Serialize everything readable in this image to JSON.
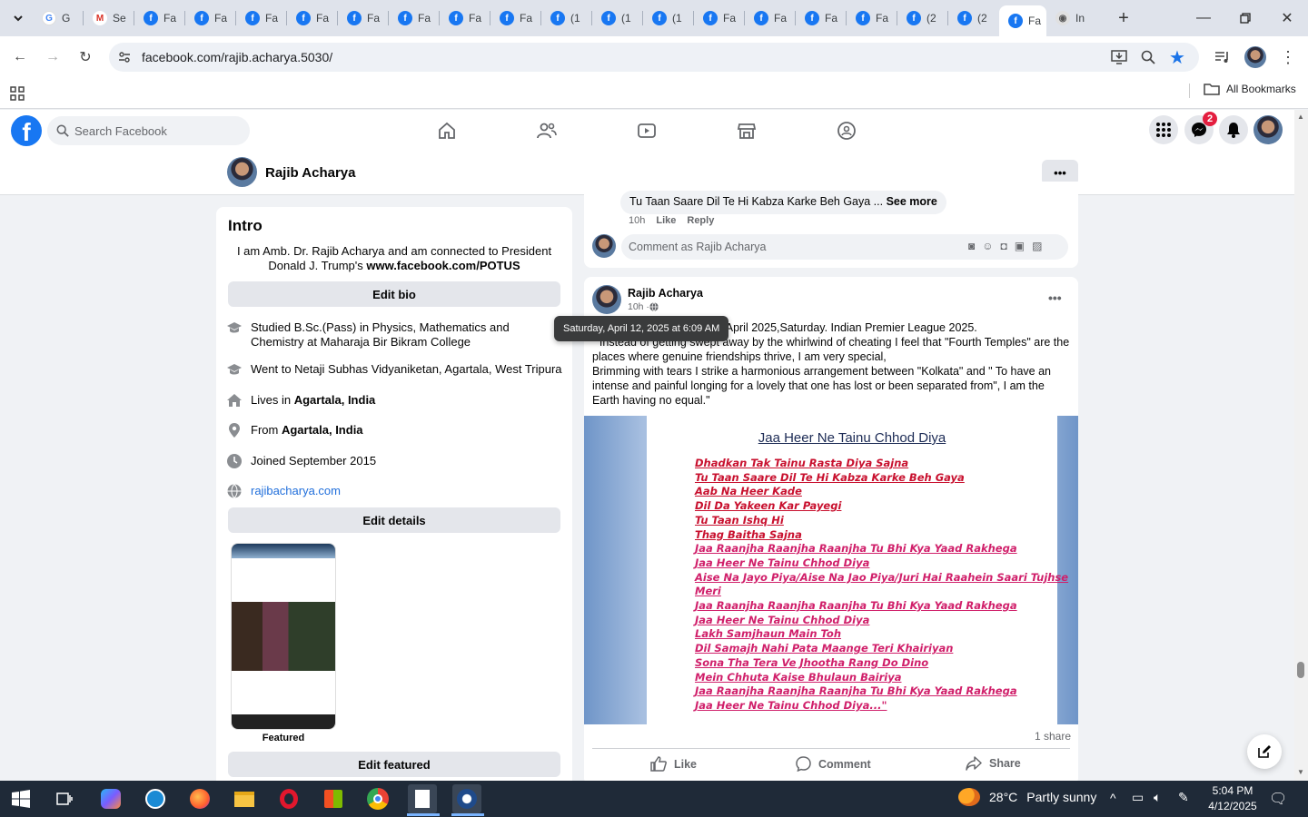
{
  "browser": {
    "tabs": [
      {
        "label": "G",
        "icon": "google"
      },
      {
        "label": "Se",
        "icon": "gmail"
      },
      {
        "label": "Fa",
        "icon": "facebook"
      },
      {
        "label": "Fa",
        "icon": "facebook"
      },
      {
        "label": "Fa",
        "icon": "facebook"
      },
      {
        "label": "Fa",
        "icon": "facebook"
      },
      {
        "label": "Fa",
        "icon": "facebook"
      },
      {
        "label": "Fa",
        "icon": "facebook"
      },
      {
        "label": "Fa",
        "icon": "facebook"
      },
      {
        "label": "Fa",
        "icon": "facebook"
      },
      {
        "label": "(1",
        "icon": "facebook"
      },
      {
        "label": "(1",
        "icon": "facebook"
      },
      {
        "label": "(1",
        "icon": "facebook"
      },
      {
        "label": "Fa",
        "icon": "facebook"
      },
      {
        "label": "Fa",
        "icon": "facebook"
      },
      {
        "label": "Fa",
        "icon": "facebook"
      },
      {
        "label": "Fa",
        "icon": "facebook"
      },
      {
        "label": "(2",
        "icon": "facebook"
      },
      {
        "label": "(2",
        "icon": "facebook"
      },
      {
        "label": "Fa",
        "icon": "facebook",
        "active": true
      },
      {
        "label": "In",
        "icon": "globe"
      }
    ],
    "url": "facebook.com/rajib.acharya.5030/",
    "bookmarks_label": "All Bookmarks"
  },
  "fb": {
    "search_placeholder": "Search Facebook",
    "messenger_badge": "2",
    "profile_name": "Rajib Acharya"
  },
  "intro": {
    "title": "Intro",
    "bio_text": "I am Amb. Dr. Rajib Acharya and am connected to President Donald J. Trump's ",
    "bio_link": "www.facebook.com/POTUS",
    "edit_bio": "Edit bio",
    "studied": "Studied B.Sc.(Pass) in Physics, Mathematics and Chemistry at Maharaja Bir Bikram College",
    "went": "Went to Netaji Subhas Vidyaniketan, Agartala, West Tripura",
    "lives_prefix": "Lives in ",
    "lives_place": "Agartala, India",
    "from_prefix": "From ",
    "from_place": "Agartala, India",
    "joined": "Joined September 2015",
    "website": "rajibacharya.com",
    "edit_details": "Edit details",
    "featured_label": "Featured",
    "edit_featured": "Edit featured"
  },
  "comment": {
    "text": "Tu Taan Saare Dil Te Hi Kabza Karke Beh Gaya ... ",
    "see_more": "See more",
    "time": "10h",
    "like": "Like",
    "reply": "Reply",
    "placeholder": "Comment as Rajib Acharya"
  },
  "post": {
    "author": "Rajib Acharya",
    "time": "10h · ",
    "tooltip": "Saturday, April 12, 2025 at 6:09 AM",
    "line1_tail": "2 April 2025,Saturday. Indian Premier League 2025.",
    "line2": "\" Instead of getting swept away by the whirlwind of cheating I feel that \"Fourth Temples\" are the places where genuine friendships thrive, I am very special,",
    "line3": "Brimming with tears I strike a harmonious arrangement between \"Kolkata\" and \" To have an intense and painful longing for a lovely  that one has lost or been separated from\", I am the Earth having no equal.\"",
    "image_title": "Jaa Heer Ne Tainu Chhod Diya",
    "poem": [
      "Dhadkan  Tak Tainu Rasta Diya Sajna",
      "Tu Taan Saare Dil Te Hi Kabza Karke Beh Gaya",
      "Aab Na Heer Kade",
      "Dil Da Yakeen Kar Payegi",
      "Tu Taan Ishq Hi",
      "Thag Baitha  Sajna",
      "Jaa Raanjha Raanjha Raanjha Tu Bhi Kya Yaad Rakhega",
      "Jaa Heer Ne Tainu Chhod Diya",
      "Aise Na Jayo Piya/Aise Na Jao Piya/Juri Hai Raahein Saari Tujhse",
      "Meri",
      "Jaa Raanjha Raanjha Raanjha Tu Bhi Kya Yaad Rakhega",
      "Jaa Heer Ne Tainu Chhod Diya",
      "Lakh Samjhaun Main Toh",
      "Dil Samajh Nahi Pata Maange Teri Khairiyan",
      "Sona Tha Tera Ve Jhootha Rang Do Dino",
      "Mein Chhuta Kaise Bhulaun Bairiya",
      "Jaa Raanjha Raanjha Raanjha Tu Bhi Kya Yaad Rakhega",
      "Jaa Heer Ne Tainu Chhod Diya...\""
    ],
    "shares": "1 share",
    "like": "Like",
    "comment": "Comment",
    "share": "Share"
  },
  "taskbar": {
    "weather_temp": "28°C",
    "weather_desc": "Partly sunny",
    "time": "5:04 PM",
    "date": "4/12/2025"
  }
}
